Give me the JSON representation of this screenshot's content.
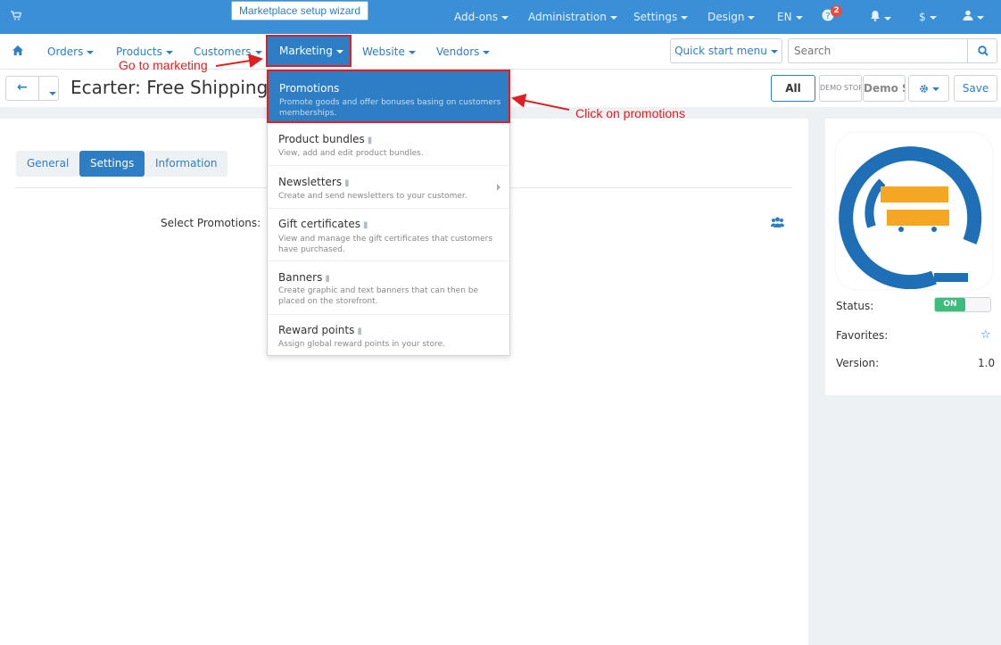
{
  "topbar": {
    "wizard_label": "Marketplace setup wizard",
    "menus": [
      "Add-ons",
      "Administration",
      "Settings",
      "Design",
      "EN"
    ],
    "notification_count": "2",
    "currency": "$",
    "icons": [
      "cart-icon",
      "help-icon",
      "bell-icon",
      "user-icon"
    ]
  },
  "nav": {
    "items": [
      "Orders",
      "Products",
      "Customers",
      "Marketing",
      "Website",
      "Vendors"
    ],
    "quick_start": "Quick start menu",
    "search_placeholder": "Search"
  },
  "toolbar": {
    "title": "Ecarter: Free Shipping",
    "all_label": "All",
    "demo_store_small": "DEMO STORE",
    "demo_store_large": "Demo Store",
    "save_label": "Save"
  },
  "tabs": [
    "General",
    "Settings",
    "Information"
  ],
  "active_tab": "Settings",
  "form": {
    "select_promotions_label": "Select Promotions:"
  },
  "sidebar": {
    "status_label": "Status:",
    "status_value": "ON",
    "favorites_label": "Favorites:",
    "version_label": "Version:",
    "version_value": "1.0"
  },
  "marketing_menu": [
    {
      "title": "Promotions",
      "desc": "Promote goods and offer bonuses basing on customers memberships.",
      "active": true
    },
    {
      "title": "Product bundles",
      "desc": "View, add and edit product bundles."
    },
    {
      "title": "Newsletters",
      "desc": "Create and send newsletters to your customer.",
      "submenu": true
    },
    {
      "title": "Gift certificates",
      "desc": "View and manage the gift certificates that customers have purchased."
    },
    {
      "title": "Banners",
      "desc": "Create graphic and text banners that can then be placed on the storefront."
    },
    {
      "title": "Reward points",
      "desc": "Assign global reward points in your store."
    }
  ],
  "annotations": {
    "go_to_marketing": "Go to marketing",
    "click_promotions": "Click on promotions"
  },
  "colors": {
    "primary": "#2d7ec4",
    "topbar": "#3a8fd6",
    "annotation": "#e02020",
    "toggle_on": "#3bbd7c",
    "logo_blue": "#1e6fb5",
    "logo_orange": "#f5a623"
  }
}
